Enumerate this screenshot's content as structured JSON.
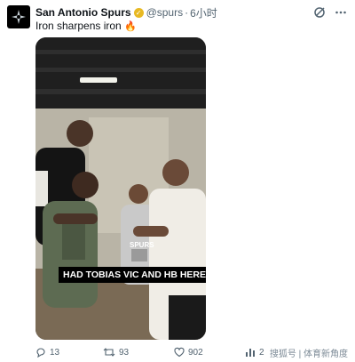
{
  "account": {
    "name": "San Antonio Spurs",
    "handle": "@spurs",
    "separator": "·",
    "time": "6小时"
  },
  "tweet": {
    "text": "Iron sharpens iron",
    "emoji": "🔥"
  },
  "media": {
    "caption": "HAD TOBIAS VIC AND HB HERE",
    "shirt_text": "SPURS"
  },
  "actions": {
    "replies": "13",
    "reposts": "93",
    "likes": "902",
    "views": "2"
  },
  "watermark": "搜狐号 | 体育新角度",
  "colors": {
    "verified_badge": "#e8b923",
    "icon_gray": "#536471"
  },
  "icons": [
    "spurs-logo-icon",
    "verified-badge-icon",
    "grok-icon",
    "more-icon",
    "reply-icon",
    "repost-icon",
    "like-icon",
    "views-icon"
  ]
}
